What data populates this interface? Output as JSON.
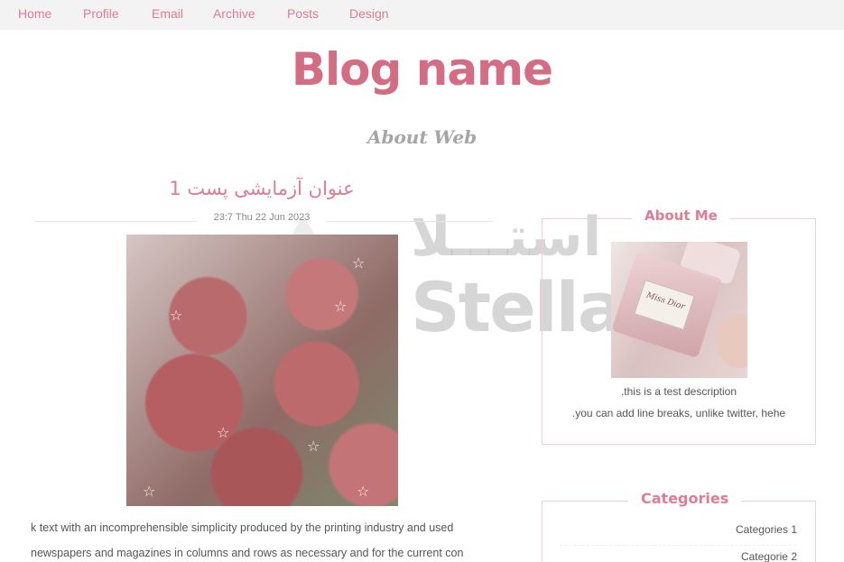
{
  "nav": {
    "items": [
      "Home",
      "Profile",
      "Email",
      "Archive",
      "Posts",
      "Design"
    ]
  },
  "header": {
    "title": "Blog name",
    "subtitle": "About Web"
  },
  "post": {
    "title": "عنوان آزمایشی پست 1",
    "date": "23:7 Thu 22 Jun 2023",
    "image_icon": "strawberries-photo",
    "text_lines": [
      "k text with an incomprehensible simplicity produced by the printing industry and used",
      "newspapers and magazines in columns and rows as necessary and for the current con"
    ]
  },
  "watermark": {
    "arabic": "استـــلا",
    "english": "Stella"
  },
  "sidebar": {
    "about": {
      "title": "About Me",
      "image_icon": "perfume-photo",
      "bottle_label": "Miss Dior",
      "desc_lines": [
        ".this is a test description",
        ".you can add line breaks, unlike twitter, hehe"
      ]
    },
    "categories": {
      "title": "Categories",
      "items": [
        "Categories 1",
        "Categorie 2"
      ]
    }
  },
  "colors": {
    "accent": "#e07b94",
    "title": "#d46d84",
    "nav_bg": "#f3f3f3",
    "box_border": "#f1cfd8"
  }
}
